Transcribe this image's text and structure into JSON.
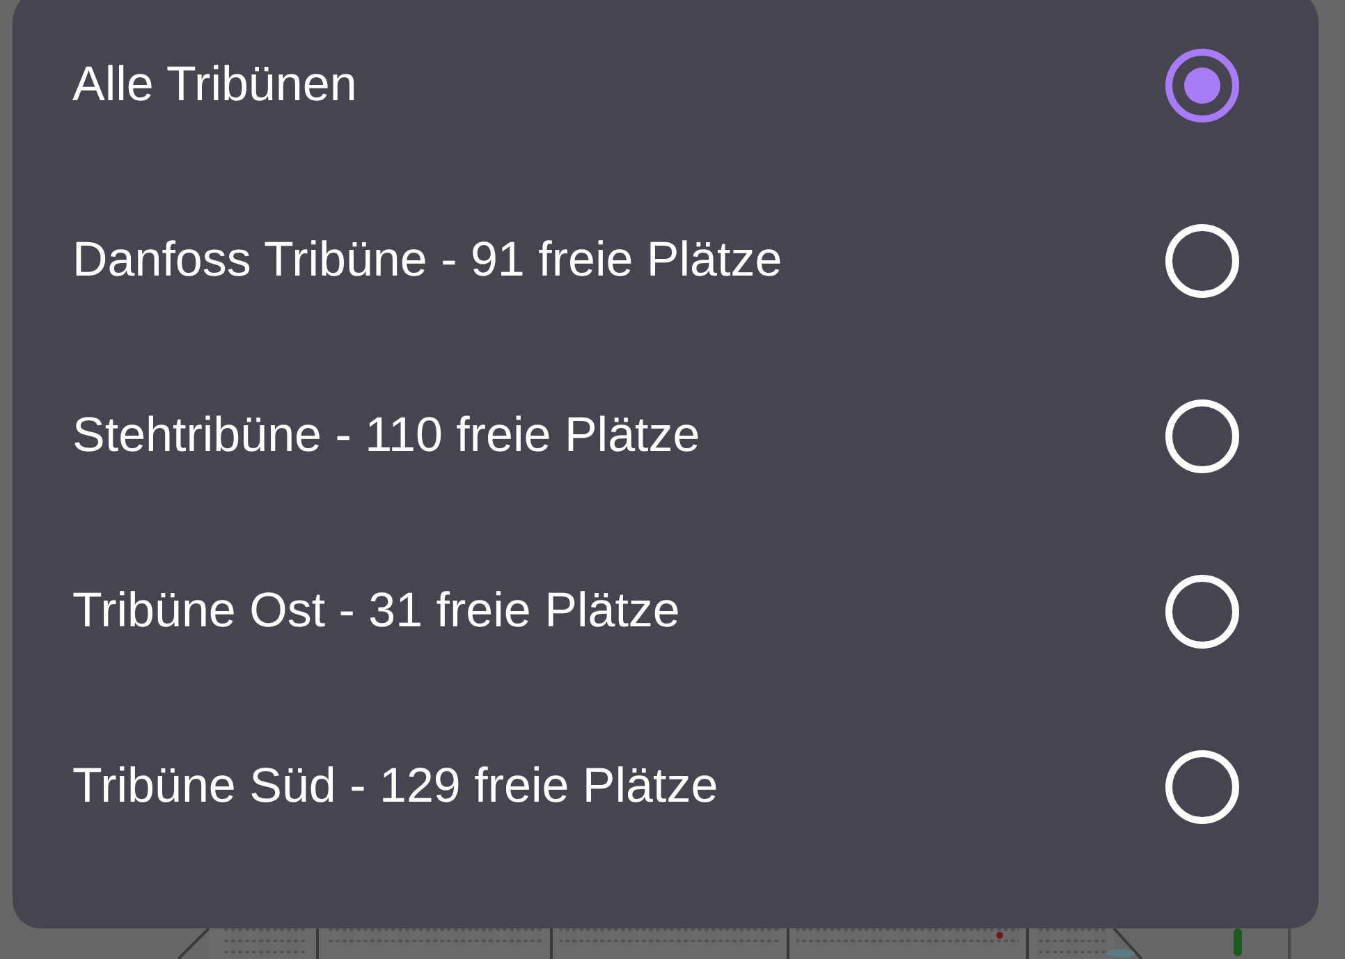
{
  "dialog": {
    "options": [
      {
        "label": "Alle Tribünen",
        "selected": true
      },
      {
        "label": "Danfoss Tribüne - 91 freie Plätze",
        "selected": false
      },
      {
        "label": "Stehtribüne - 110 freie Plätze",
        "selected": false
      },
      {
        "label": "Tribüne Ost - 31 freie Plätze",
        "selected": false
      },
      {
        "label": "Tribüne Süd - 129 freie Plätze",
        "selected": false
      }
    ]
  }
}
